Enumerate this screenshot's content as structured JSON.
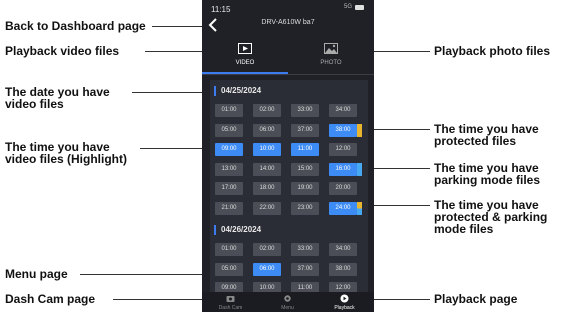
{
  "status_bar": {
    "time": "11:15",
    "network": "5G"
  },
  "header": {
    "device_name": "DRV-A610W ba7"
  },
  "tabs": [
    {
      "label": "VIDEO",
      "active": true,
      "icon": "video-icon"
    },
    {
      "label": "PHOTO",
      "active": false,
      "icon": "photo-icon"
    }
  ],
  "groups": [
    {
      "date": "04/25/2024",
      "rows": [
        [
          {
            "t": "01:00"
          },
          {
            "t": "02:00"
          },
          {
            "t": "33:00"
          },
          {
            "t": "34:00"
          }
        ],
        [
          {
            "t": "05:00"
          },
          {
            "t": "06:00"
          },
          {
            "t": "37:00"
          },
          {
            "t": "38:00",
            "hl": true,
            "tag": "protected"
          }
        ],
        [
          {
            "t": "09:00",
            "hl": true
          },
          {
            "t": "10:00",
            "hl": true
          },
          {
            "t": "11:00",
            "hl": true
          },
          {
            "t": "12:00"
          }
        ],
        [
          {
            "t": "13:00"
          },
          {
            "t": "14:00"
          },
          {
            "t": "15:00"
          },
          {
            "t": "16:00",
            "hl": true,
            "tag": "parking"
          }
        ],
        [
          {
            "t": "17:00"
          },
          {
            "t": "18:00"
          },
          {
            "t": "19:00"
          },
          {
            "t": "20:00"
          }
        ],
        [
          {
            "t": "21:00"
          },
          {
            "t": "22:00"
          },
          {
            "t": "23:00"
          },
          {
            "t": "24:00",
            "hl": true,
            "tag": "protected-parking"
          }
        ]
      ]
    },
    {
      "date": "04/26/2024",
      "rows": [
        [
          {
            "t": "01:00"
          },
          {
            "t": "02:00"
          },
          {
            "t": "33:00"
          },
          {
            "t": "34:00"
          }
        ],
        [
          {
            "t": "05:00"
          },
          {
            "t": "06:00",
            "hl": true
          },
          {
            "t": "37:00"
          },
          {
            "t": "38:00"
          }
        ],
        [
          {
            "t": "09:00"
          },
          {
            "t": "10:00"
          },
          {
            "t": "11:00"
          },
          {
            "t": "12:00"
          }
        ]
      ]
    }
  ],
  "bottom_nav": [
    {
      "label": "Dash Cam",
      "icon": "camera-icon",
      "active": false
    },
    {
      "label": "Menu",
      "icon": "gear-icon",
      "active": false
    },
    {
      "label": "Playback",
      "icon": "play-icon",
      "active": true
    }
  ],
  "annotations": {
    "back": "Back to Dashboard page",
    "video": "Playback video files",
    "photo": "Playback photo files",
    "date_line1": "The date you have",
    "date_line2": "video files",
    "time_line1": "The time you have",
    "time_line2": "video files (Highlight)",
    "protected_line1": "The time you have",
    "protected_line2": "protected files",
    "parking_line1": "The time you have",
    "parking_line2": "parking mode files",
    "pp_line1": "The time you have",
    "pp_line2": "protected & parking",
    "pp_line3": "mode files",
    "menu": "Menu page",
    "dashcam": "Dash Cam page",
    "playback": "Playback page"
  },
  "colors": {
    "accent": "#3d8bf5",
    "protected": "#e8b530",
    "parking": "#47a9f1",
    "background": "#1f2127"
  }
}
